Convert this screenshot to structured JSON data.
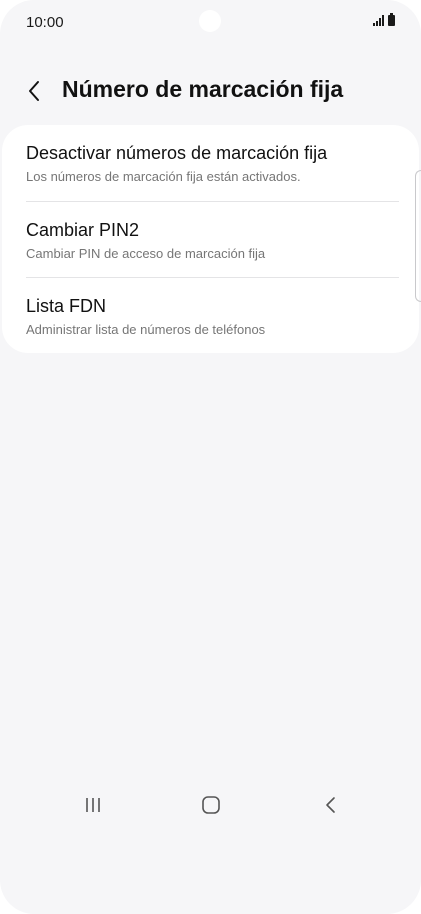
{
  "status_bar": {
    "time": "10:00",
    "icons": [
      "signal-icon",
      "battery-icon"
    ]
  },
  "header": {
    "back_icon": "chevron-left-icon",
    "title": "Número de marcación fija"
  },
  "settings": {
    "items": [
      {
        "title": "Desactivar números de marcación fija",
        "subtitle": "Los números de marcación fija están activados."
      },
      {
        "title": "Cambiar PIN2",
        "subtitle": "Cambiar PIN de acceso de marcación fija"
      },
      {
        "title": "Lista FDN",
        "subtitle": "Administrar lista de números de teléfonos"
      }
    ]
  },
  "nav_bar": {
    "buttons": [
      "recent-apps-icon",
      "home-icon",
      "back-icon"
    ]
  },
  "colors": {
    "background": "#f6f6f8",
    "card": "#ffffff",
    "text_primary": "#111111",
    "text_secondary": "#767676"
  }
}
